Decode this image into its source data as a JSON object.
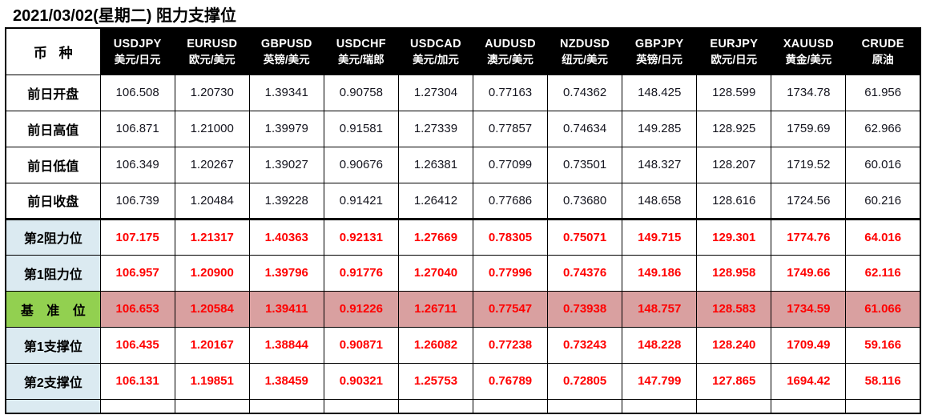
{
  "title": "2021/03/02(星期二) 阻力支撑位",
  "table": {
    "label_header": "币 种",
    "columns": [
      {
        "symbol": "USDJPY",
        "cn": "美元/日元"
      },
      {
        "symbol": "EURUSD",
        "cn": "欧元/美元"
      },
      {
        "symbol": "GBPUSD",
        "cn": "英镑/美元"
      },
      {
        "symbol": "USDCHF",
        "cn": "美元/瑞郎"
      },
      {
        "symbol": "USDCAD",
        "cn": "美元/加元"
      },
      {
        "symbol": "AUDUSD",
        "cn": "澳元/美元"
      },
      {
        "symbol": "NZDUSD",
        "cn": "纽元/美元"
      },
      {
        "symbol": "GBPJPY",
        "cn": "英镑/日元"
      },
      {
        "symbol": "EURJPY",
        "cn": "欧元/日元"
      },
      {
        "symbol": "XAUUSD",
        "cn": "黄金/美元"
      },
      {
        "symbol": "CRUDE",
        "cn": "原油"
      }
    ],
    "rows": [
      {
        "label": "前日开盘",
        "kind": "prev",
        "values": [
          "106.508",
          "1.20730",
          "1.39341",
          "0.90758",
          "1.27304",
          "0.77163",
          "0.74362",
          "148.425",
          "128.599",
          "1734.78",
          "61.956"
        ]
      },
      {
        "label": "前日高值",
        "kind": "prev",
        "values": [
          "106.871",
          "1.21000",
          "1.39979",
          "0.91581",
          "1.27339",
          "0.77857",
          "0.74634",
          "149.285",
          "128.925",
          "1759.69",
          "62.966"
        ]
      },
      {
        "label": "前日低值",
        "kind": "prev",
        "values": [
          "106.349",
          "1.20267",
          "1.39027",
          "0.90676",
          "1.26381",
          "0.77099",
          "0.73501",
          "148.327",
          "128.207",
          "1719.52",
          "60.016"
        ]
      },
      {
        "label": "前日收盘",
        "kind": "prev",
        "values": [
          "106.739",
          "1.20484",
          "1.39228",
          "0.91421",
          "1.26412",
          "0.77686",
          "0.73680",
          "148.658",
          "128.616",
          "1724.56",
          "60.216"
        ]
      },
      {
        "label": "第2阻力位",
        "kind": "level",
        "values": [
          "107.175",
          "1.21317",
          "1.40363",
          "0.92131",
          "1.27669",
          "0.78305",
          "0.75071",
          "149.715",
          "129.301",
          "1774.76",
          "64.016"
        ]
      },
      {
        "label": "第1阻力位",
        "kind": "level",
        "values": [
          "106.957",
          "1.20900",
          "1.39796",
          "0.91776",
          "1.27040",
          "0.77996",
          "0.74376",
          "149.186",
          "128.958",
          "1749.66",
          "62.116"
        ]
      },
      {
        "label": "基 准 位",
        "kind": "pivot",
        "values": [
          "106.653",
          "1.20584",
          "1.39411",
          "0.91226",
          "1.26711",
          "0.77547",
          "0.73938",
          "148.757",
          "128.583",
          "1734.59",
          "61.066"
        ]
      },
      {
        "label": "第1支撑位",
        "kind": "level",
        "values": [
          "106.435",
          "1.20167",
          "1.38844",
          "0.90871",
          "1.26082",
          "0.77238",
          "0.73243",
          "148.228",
          "128.240",
          "1709.49",
          "59.166"
        ]
      },
      {
        "label": "第2支撑位",
        "kind": "level",
        "values": [
          "106.131",
          "1.19851",
          "1.38459",
          "0.90321",
          "1.25753",
          "0.76789",
          "0.72805",
          "147.799",
          "127.865",
          "1694.42",
          "58.116"
        ]
      }
    ]
  },
  "colors": {
    "header_background": "#000000",
    "header_text": "#ffffff",
    "level_value_text": "#ff0000",
    "level_label_background": "#dbeaf1",
    "pivot_label_background": "#92d050",
    "pivot_row_background": "#d9a0a0",
    "prev_value_text": "#14141e"
  }
}
